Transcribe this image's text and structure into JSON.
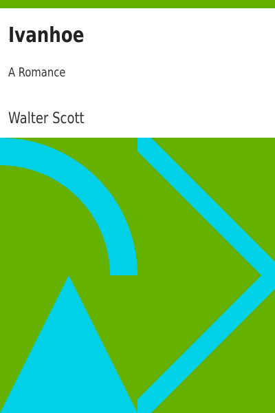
{
  "book": {
    "title": "Ivanhoe",
    "subtitle": "A Romance",
    "author": "Walter Scott"
  },
  "colors": {
    "background_green": "#66b000",
    "accent_cyan": "#00d0e6",
    "panel": "#ffffff"
  }
}
